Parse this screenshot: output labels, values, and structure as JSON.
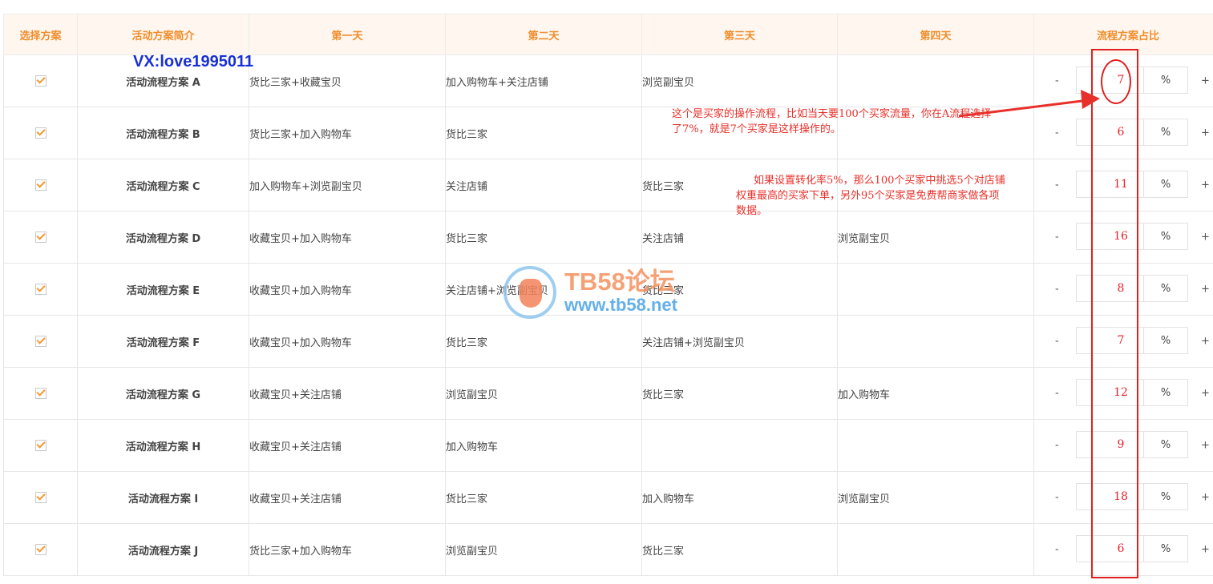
{
  "headers": {
    "select": "选择方案",
    "intro": "活动方案简介",
    "day1": "第一天",
    "day2": "第二天",
    "day3": "第三天",
    "day4": "第四天",
    "ratio": "流程方案占比"
  },
  "controls": {
    "minus": "-",
    "plus": "+",
    "unit": "%"
  },
  "rows": [
    {
      "name": "活动流程方案 A",
      "checked": true,
      "day1": "货比三家+收藏宝贝",
      "day2": "加入购物车+关注店铺",
      "day3": "浏览副宝贝",
      "day4": "",
      "ratio": "7"
    },
    {
      "name": "活动流程方案 B",
      "checked": true,
      "day1": "货比三家+加入购物车",
      "day2": "货比三家",
      "day3": "",
      "day4": "",
      "ratio": "6"
    },
    {
      "name": "活动流程方案 C",
      "checked": true,
      "day1": "加入购物车+浏览副宝贝",
      "day2": "关注店铺",
      "day3": "货比三家",
      "day4": "",
      "ratio": "11"
    },
    {
      "name": "活动流程方案 D",
      "checked": true,
      "day1": "收藏宝贝+加入购物车",
      "day2": "货比三家",
      "day3": "关注店铺",
      "day4": "浏览副宝贝",
      "ratio": "16"
    },
    {
      "name": "活动流程方案 E",
      "checked": true,
      "day1": "收藏宝贝+加入购物车",
      "day2": "关注店铺+浏览副宝贝",
      "day3": "货比三家",
      "day4": "",
      "ratio": "8"
    },
    {
      "name": "活动流程方案 F",
      "checked": true,
      "day1": "收藏宝贝+加入购物车",
      "day2": "货比三家",
      "day3": "关注店铺+浏览副宝贝",
      "day4": "",
      "ratio": "7"
    },
    {
      "name": "活动流程方案 G",
      "checked": true,
      "day1": "收藏宝贝+关注店铺",
      "day2": "浏览副宝贝",
      "day3": "货比三家",
      "day4": "加入购物车",
      "ratio": "12"
    },
    {
      "name": "活动流程方案 H",
      "checked": true,
      "day1": "收藏宝贝+关注店铺",
      "day2": "加入购物车",
      "day3": "",
      "day4": "",
      "ratio": "9"
    },
    {
      "name": "活动流程方案 I",
      "checked": true,
      "day1": "收藏宝贝+关注店铺",
      "day2": "货比三家",
      "day3": "加入购物车",
      "day4": "浏览副宝贝",
      "ratio": "18"
    },
    {
      "name": "活动流程方案 J",
      "checked": true,
      "day1": "货比三家+加入购物车",
      "day2": "浏览副宝贝",
      "day3": "货比三家",
      "day4": "",
      "ratio": "6"
    }
  ],
  "overlay": {
    "vx": "VX:love1995011",
    "note1": "这个是买家的操作流程，比如当天要100个买家流量，你在A流程选择了7%，就是7个买家是这样操作的。",
    "note2": "如果设置转化率5%，那么100个买家中挑选5个对店铺权重最高的买家下单，另外95个买家是免费帮商家做各项数据。",
    "watermark_title": "TB58论坛",
    "watermark_url": "www.tb58.net",
    "annotation_color": "#e02020"
  }
}
